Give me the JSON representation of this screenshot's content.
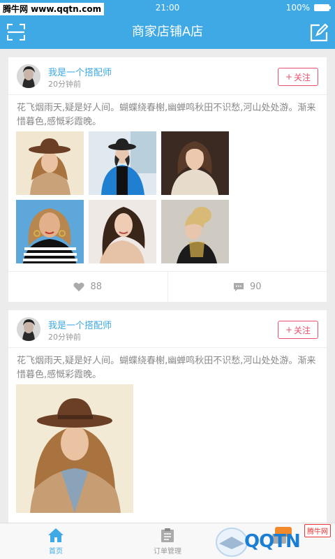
{
  "watermark_top": "腾牛网 www.qqtn.com",
  "status_bar": {
    "time": "21:00",
    "battery": "100%"
  },
  "header": {
    "title": "商家店铺A店",
    "scan_icon": "scan-icon",
    "edit_icon": "edit-icon"
  },
  "posts": [
    {
      "author": "我是一个搭配师",
      "time_ago": "20分钟前",
      "follow_label": "关注",
      "text": "花飞烟雨天,疑是好人间。蝴蝶绕春榭,幽蝉鸣秋田不识愁,河山处处游。渐来惜暮色,感慨彩霞晚。",
      "likes": "88",
      "comments": "90"
    },
    {
      "author": "我是一个搭配师",
      "time_ago": "20分钟前",
      "follow_label": "关注",
      "text": "花飞烟雨天,疑是好人间。蝴蝶绕春榭,幽蝉鸣秋田不识愁,河山处处游。渐来惜暮色,感慨彩霞晚。"
    }
  ],
  "tabs": [
    {
      "label": "首页",
      "icon": "home-icon",
      "active": true
    },
    {
      "label": "订单管理",
      "icon": "clipboard-icon",
      "active": false
    },
    {
      "label": "",
      "icon": "message-icon",
      "active": false
    }
  ],
  "watermark_bottom": {
    "logo": "QQTN",
    "site": "腾牛网"
  },
  "colors": {
    "accent": "#3fa9e6",
    "follow": "#e8506e",
    "background": "#ececec"
  }
}
